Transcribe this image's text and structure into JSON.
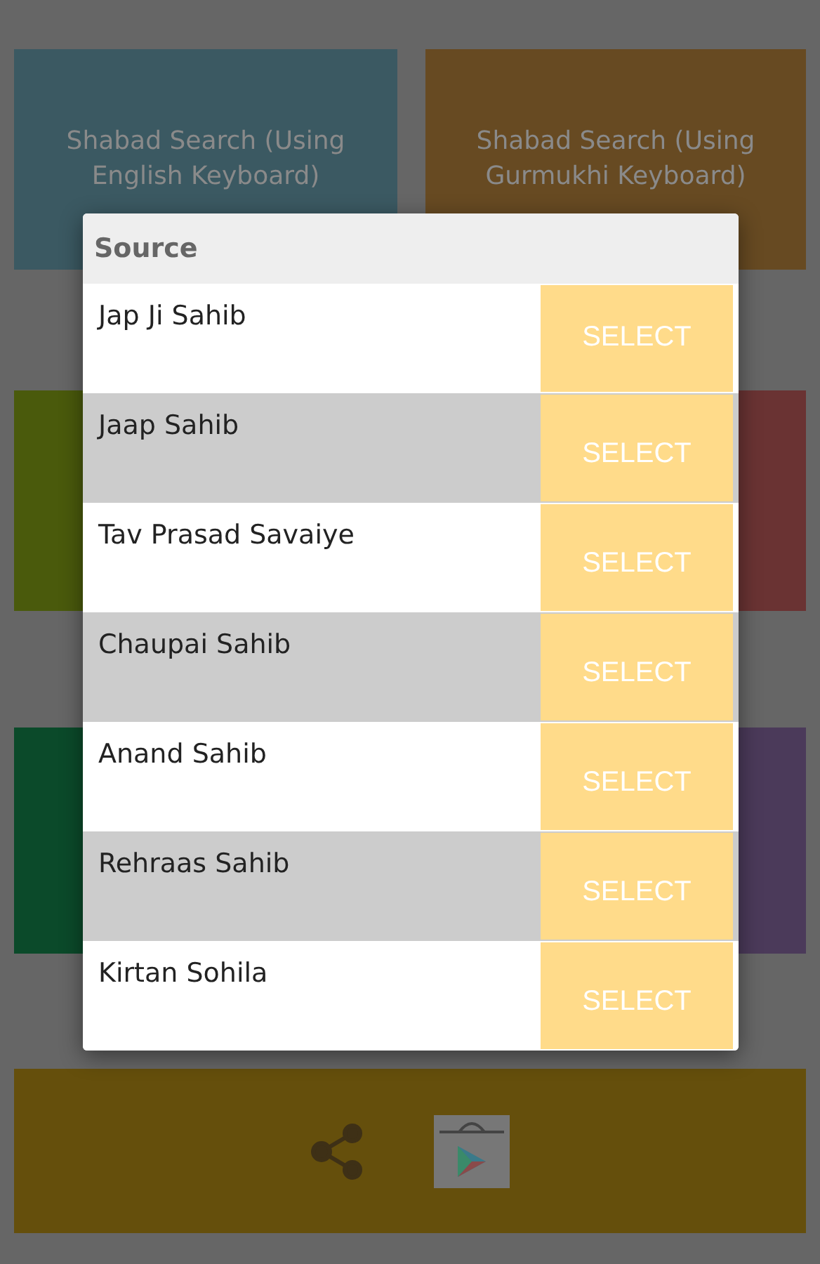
{
  "tiles": [
    {
      "label": "Shabad Search (Using English Keyboard)",
      "color": "#3b5962"
    },
    {
      "label": "Shabad Search (Using Gurmukhi Keyboard)",
      "color": "#674a22"
    },
    {
      "color": "#4a5a0c"
    },
    {
      "color": "#6a3333"
    },
    {
      "color": "#0b4a2a"
    },
    {
      "color": "#4b3a5a"
    }
  ],
  "dialog": {
    "title": "Source",
    "items": [
      {
        "name": "Jap Ji Sahib",
        "button": "SELECT"
      },
      {
        "name": "Jaap Sahib",
        "button": "SELECT"
      },
      {
        "name": "Tav Prasad Savaiye",
        "button": "SELECT"
      },
      {
        "name": "Chaupai Sahib",
        "button": "SELECT"
      },
      {
        "name": "Anand Sahib",
        "button": "SELECT"
      },
      {
        "name": "Rehraas Sahib",
        "button": "SELECT"
      },
      {
        "name": "Kirtan Sohila",
        "button": "SELECT"
      }
    ]
  }
}
